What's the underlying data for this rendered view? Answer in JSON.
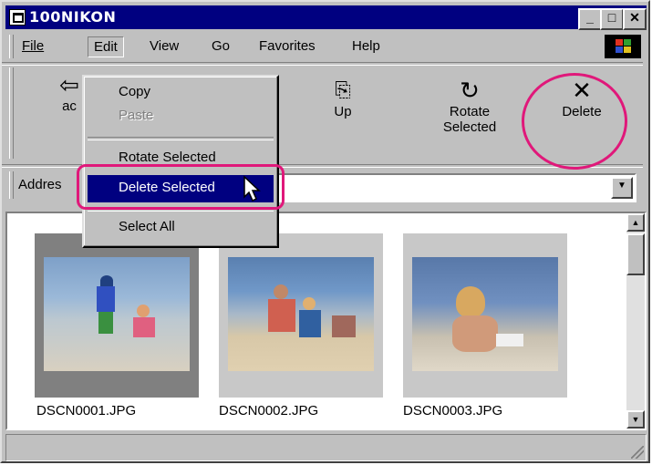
{
  "window": {
    "title": "100NIKON"
  },
  "menubar": {
    "items": [
      "File",
      "Edit",
      "View",
      "Go",
      "Favorites",
      "Help"
    ]
  },
  "toolbar": {
    "back_label": "ac",
    "up_label": "Up",
    "rotate_label_1": "Rotate",
    "rotate_label_2": "Selected",
    "delete_label": "Delete"
  },
  "address": {
    "label": "Addres"
  },
  "edit_menu": {
    "copy": "Copy",
    "paste": "Paste",
    "rotate_selected": "Rotate Selected",
    "delete_selected": "Delete Selected",
    "select_all": "Select All"
  },
  "files": [
    {
      "name": "DSCN0001.JPG",
      "selected": true
    },
    {
      "name": "DSCN0002.JPG",
      "selected": false
    },
    {
      "name": "DSCN0003.JPG",
      "selected": false
    }
  ],
  "colors": {
    "title_bar": "#000080",
    "highlight": "#000080",
    "annotation": "#e0187a",
    "face": "#c0c0c0"
  }
}
